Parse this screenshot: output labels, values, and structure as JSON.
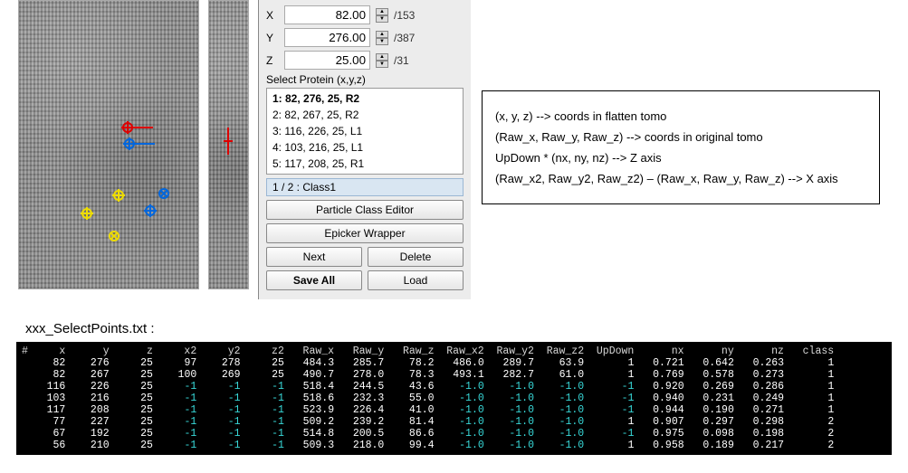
{
  "coords": {
    "X": {
      "label": "X",
      "value": "82.00",
      "max": "/153"
    },
    "Y": {
      "label": "Y",
      "value": "276.00",
      "max": "/387"
    },
    "Z": {
      "label": "Z",
      "value": "25.00",
      "max": "/31"
    }
  },
  "select_label": "Select Protein (x,y,z)",
  "proteins": [
    "1: 82, 276, 25, R2",
    "2: 82, 267, 25, R2",
    "3: 116, 226, 25, L1",
    "4: 103, 216, 25, L1",
    "5: 117, 208, 25, R1"
  ],
  "class_bar": "1 / 2 : Class1",
  "buttons": {
    "pce": "Particle Class Editor",
    "ew": "Epicker Wrapper",
    "next": "Next",
    "delete": "Delete",
    "save": "Save All",
    "load": "Load"
  },
  "legend": {
    "l1": "(x, y, z) --> coords in flatten tomo",
    "l2": "(Raw_x, Raw_y, Raw_z) --> coords in original tomo",
    "l3": "UpDown * (nx, ny, nz) --> Z axis",
    "l4": "(Raw_x2, Raw_y2, Raw_z2) – (Raw_x, Raw_y, Raw_z) --> X axis"
  },
  "file_label": "xxx_SelectPoints.txt :",
  "chart_data": {
    "type": "table",
    "columns": [
      "x",
      "y",
      "z",
      "x2",
      "y2",
      "z2",
      "Raw_x",
      "Raw_y",
      "Raw_z",
      "Raw_x2",
      "Raw_y2",
      "Raw_z2",
      "UpDown",
      "nx",
      "ny",
      "nz",
      "class"
    ],
    "rows": [
      [
        82,
        276,
        25,
        97,
        278,
        25,
        484.3,
        285.7,
        78.2,
        486.0,
        289.7,
        63.9,
        1,
        0.721,
        0.642,
        0.263,
        1
      ],
      [
        82,
        267,
        25,
        100,
        269,
        25,
        490.7,
        278.0,
        78.3,
        493.1,
        282.7,
        61.0,
        1,
        0.769,
        0.578,
        0.273,
        1
      ],
      [
        116,
        226,
        25,
        -1,
        -1,
        -1,
        518.4,
        244.5,
        43.6,
        -1.0,
        -1.0,
        -1.0,
        -1,
        0.92,
        0.269,
        0.286,
        1
      ],
      [
        103,
        216,
        25,
        -1,
        -1,
        -1,
        518.6,
        232.3,
        55.0,
        -1.0,
        -1.0,
        -1.0,
        -1,
        0.94,
        0.231,
        0.249,
        1
      ],
      [
        117,
        208,
        25,
        -1,
        -1,
        -1,
        523.9,
        226.4,
        41.0,
        -1.0,
        -1.0,
        -1.0,
        -1,
        0.944,
        0.19,
        0.271,
        1
      ],
      [
        77,
        227,
        25,
        -1,
        -1,
        -1,
        509.2,
        239.2,
        81.4,
        -1.0,
        -1.0,
        -1.0,
        1,
        0.907,
        0.297,
        0.298,
        2
      ],
      [
        67,
        192,
        25,
        -1,
        -1,
        -1,
        514.8,
        200.5,
        86.6,
        -1.0,
        -1.0,
        -1.0,
        -1,
        0.975,
        0.098,
        0.198,
        2
      ],
      [
        56,
        210,
        25,
        -1,
        -1,
        -1,
        509.3,
        218.0,
        99.4,
        -1.0,
        -1.0,
        -1.0,
        1,
        0.958,
        0.189,
        0.217,
        2
      ]
    ]
  }
}
